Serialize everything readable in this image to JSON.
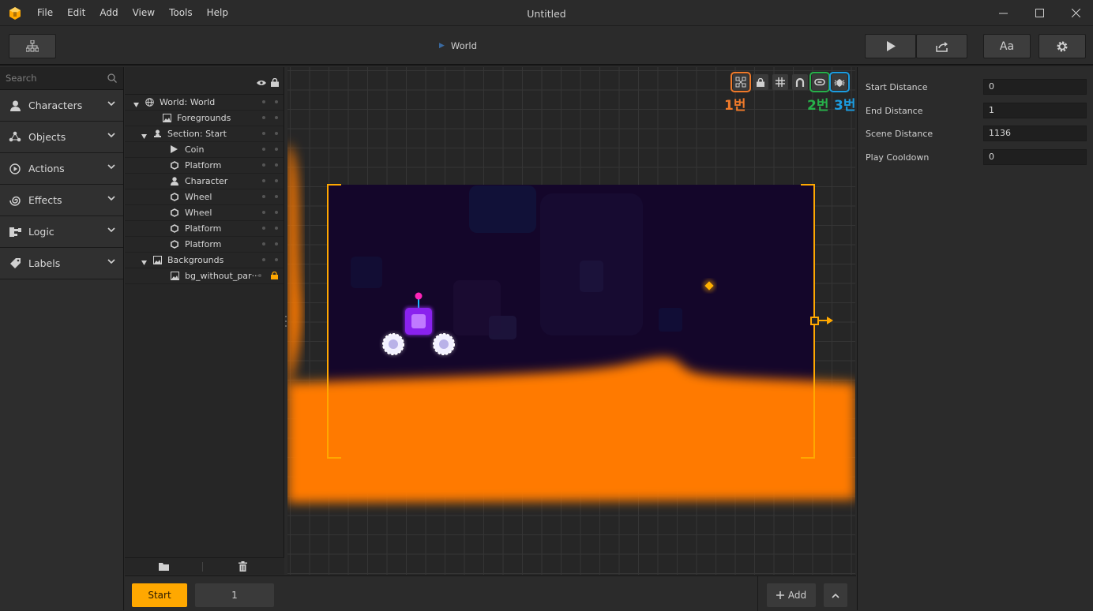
{
  "window": {
    "title": "Untitled"
  },
  "menu": [
    "File",
    "Edit",
    "Add",
    "View",
    "Tools",
    "Help"
  ],
  "breadcrumb": {
    "label": "World"
  },
  "toolbar": {
    "font_button_label": "Aa"
  },
  "search": {
    "placeholder": "Search"
  },
  "categories": [
    {
      "label": "Characters",
      "icon": "person-icon"
    },
    {
      "label": "Objects",
      "icon": "objects-icon"
    },
    {
      "label": "Actions",
      "icon": "play-circle-icon"
    },
    {
      "label": "Effects",
      "icon": "spiral-icon"
    },
    {
      "label": "Logic",
      "icon": "logic-icon"
    },
    {
      "label": "Labels",
      "icon": "tag-icon"
    }
  ],
  "tree": [
    {
      "label": "World: World",
      "icon": "globe-icon"
    },
    {
      "label": "Foregrounds",
      "icon": "image-icon"
    },
    {
      "label": "Section: Start",
      "icon": "section-icon"
    },
    {
      "label": "Coin",
      "icon": "play-icon"
    },
    {
      "label": "Platform",
      "icon": "hexagon-icon"
    },
    {
      "label": "Character",
      "icon": "person-icon"
    },
    {
      "label": "Wheel",
      "icon": "hexagon-icon"
    },
    {
      "label": "Wheel",
      "icon": "hexagon-icon"
    },
    {
      "label": "Platform",
      "icon": "hexagon-icon"
    },
    {
      "label": "Platform",
      "icon": "hexagon-icon"
    },
    {
      "label": "Backgrounds",
      "icon": "image-icon"
    },
    {
      "label": "bg_without_par···",
      "icon": "image-icon"
    }
  ],
  "annotations": [
    {
      "label": "1번",
      "color": "#f07a2a"
    },
    {
      "label": "2번",
      "color": "#27b04a"
    },
    {
      "label": "3번",
      "color": "#1c9ce0"
    }
  ],
  "properties": [
    {
      "label": "Start Distance",
      "value": "0"
    },
    {
      "label": "End Distance",
      "value": "1"
    },
    {
      "label": "Scene Distance",
      "value": "1136"
    },
    {
      "label": "Play Cooldown",
      "value": "0"
    }
  ],
  "bottom": {
    "start_label": "Start",
    "section_value": "1",
    "add_label": "Add"
  },
  "colors": {
    "accent": "#ffa800",
    "ground": "#ff7a00",
    "scene_bg": "#14062a",
    "character": "#9b30ff"
  }
}
